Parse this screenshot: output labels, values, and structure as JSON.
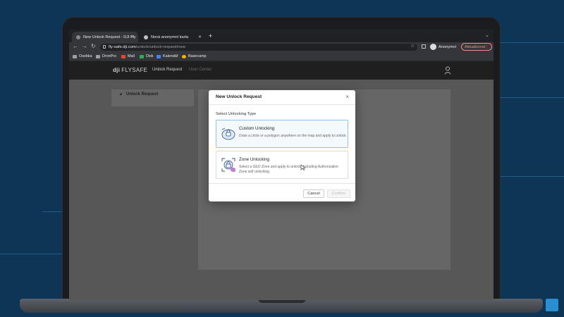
{
  "browser": {
    "tabs": [
      {
        "label": "New Unlock Request - DJI Fly"
      },
      {
        "label": "Nová anonymní karta"
      }
    ],
    "url_host": "fly-safe.dji.com",
    "url_path": "/unlock/unlock-request/new",
    "profile_label": "Anonymní",
    "update_button_label": "Aktualizovat",
    "bookmarks": [
      "Osobka",
      "DronPro",
      "Mail",
      "Disk",
      "Kalendář",
      "Basecamp"
    ]
  },
  "app": {
    "logo_brand": "dji",
    "logo_product": "FLYSAFE",
    "nav": [
      "Unlock Request",
      "User Center"
    ],
    "sidebar_item": "Unlock Request"
  },
  "modal": {
    "title": "New Unlock Request",
    "subtitle": "Select Unlocking Type",
    "options": [
      {
        "title": "Custom Unlocking",
        "description": "Draw a circle or a polygon anywhere on the map and apply to unlock",
        "selected": true
      },
      {
        "title": "Zone Unlocking",
        "description": "Select a GEO Zone and apply to unlock. Including Authorization Zone self unlocking",
        "selected": false
      }
    ],
    "cancel_label": "Cancel",
    "confirm_label": "Confirm"
  },
  "colors": {
    "background": "#0f3556",
    "accent": "#2a8fd0",
    "selected_border": "#8fc4e8",
    "update_red": "#f28b82"
  }
}
